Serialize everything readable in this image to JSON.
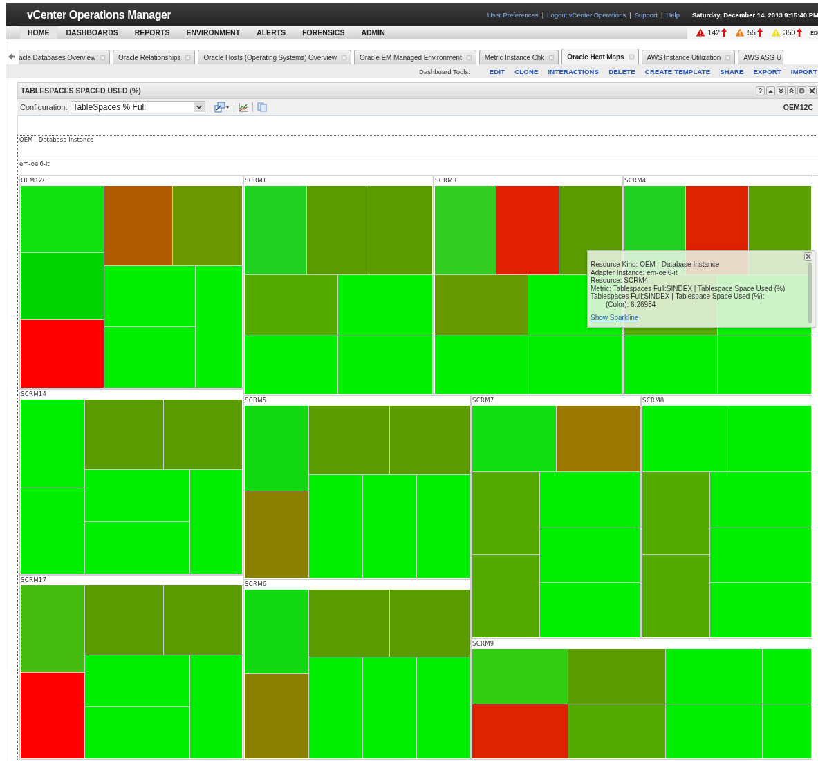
{
  "header": {
    "title": "vCenter Operations Manager",
    "links": [
      "User Preferences",
      "Logout vCenter Operations",
      "Support",
      "Help"
    ],
    "separator": "|",
    "datetime": "Saturday, December 14, 2013 9:15:40 PM"
  },
  "nav": {
    "items": [
      {
        "label": "HOME",
        "selected": true
      },
      {
        "label": "DASHBOARDS",
        "selected": false
      },
      {
        "label": "REPORTS",
        "selected": false
      },
      {
        "label": "ENVIRONMENT",
        "selected": false
      },
      {
        "label": "ALERTS",
        "selected": false
      },
      {
        "label": "FORENSICS",
        "selected": false
      },
      {
        "label": "ADMIN",
        "selected": false
      }
    ],
    "alerts": [
      {
        "kind": "critical",
        "count": "142"
      },
      {
        "kind": "immediate",
        "count": "55"
      },
      {
        "kind": "warning",
        "count": "350"
      }
    ],
    "edit_cut": "EDI"
  },
  "tabs": [
    {
      "label": "acle Databases Overview",
      "selected": false
    },
    {
      "label": "Oracle Relationships",
      "selected": false
    },
    {
      "label": "Oracle Hosts (Operating Systems) Overview",
      "selected": false
    },
    {
      "label": "Oracle EM Managed Environment",
      "selected": false
    },
    {
      "label": "Metric Instance Chk",
      "selected": false
    },
    {
      "label": "Oracle Heat Maps",
      "selected": true
    },
    {
      "label": "AWS Instance Utilization",
      "selected": false
    },
    {
      "label": "AWS ASG U",
      "selected": false
    }
  ],
  "dashboard_tools": {
    "label": "Dashboard Tools:",
    "actions": [
      "EDIT",
      "CLONE",
      "INTERACTIONS",
      "DELETE",
      "CREATE TEMPLATE",
      "SHARE",
      "EXPORT",
      "IMPORT"
    ]
  },
  "panel": {
    "title": "TABLESPACES SPACED USED (%)",
    "help": "?",
    "config_label": "Configuration:",
    "config_value": "TableSpaces % Full",
    "resource": "OEM12C"
  },
  "heatmap": {
    "kind_label": "OEM - Database Instance",
    "adapter_label": "em-oel6-it",
    "groups": [
      {
        "name": "OEM12C",
        "tiles": [
          {
            "color": "#11e011"
          },
          {
            "color": "#00d400"
          },
          {
            "color": "#ff0000"
          },
          {
            "color": "#b05a00"
          },
          {
            "color": "#6a9600"
          },
          {
            "color": "#00ee00"
          },
          {
            "color": "#00ee00"
          },
          {
            "color": "#00ee00"
          }
        ]
      },
      {
        "name": "SCRM1",
        "tiles": [
          {
            "color": "#22d022"
          },
          {
            "color": "#5a9c00"
          },
          {
            "color": "#5a9c00"
          },
          {
            "color": "#55aa00"
          },
          {
            "color": "#00ee00"
          },
          {
            "color": "#00ee00"
          },
          {
            "color": "#00ee00"
          }
        ]
      },
      {
        "name": "SCRM3",
        "tiles": [
          {
            "color": "#33cc22"
          },
          {
            "color": "#e02000"
          },
          {
            "color": "#5a9c00"
          },
          {
            "color": "#669900"
          },
          {
            "color": "#00ee00"
          },
          {
            "color": "#00ee00"
          },
          {
            "color": "#00ee00"
          }
        ]
      },
      {
        "name": "SCRM4",
        "tiles": [
          {
            "color": "#22d022"
          },
          {
            "color": "#dd2200"
          },
          {
            "color": "#5aa000"
          },
          {
            "color": "#55aa00"
          },
          {
            "color": "#00ee00"
          },
          {
            "color": "#00ee00"
          },
          {
            "color": "#00ee00"
          }
        ]
      },
      {
        "name": "SCRM14",
        "tiles": [
          {
            "color": "#00ee00"
          },
          {
            "color": "#00ee00"
          },
          {
            "color": "#5a9c00"
          },
          {
            "color": "#5a9c00"
          },
          {
            "color": "#00ee00"
          },
          {
            "color": "#00ee00"
          },
          {
            "color": "#00ee00"
          }
        ]
      },
      {
        "name": "SCRM5",
        "tiles": [
          {
            "color": "#11d811"
          },
          {
            "color": "#8a8000"
          },
          {
            "color": "#5a9c00"
          },
          {
            "color": "#5a9c00"
          },
          {
            "color": "#00ee00"
          },
          {
            "color": "#00ee00"
          },
          {
            "color": "#00ee00"
          }
        ]
      },
      {
        "name": "SCRM7",
        "tiles": [
          {
            "color": "#11dd11"
          },
          {
            "color": "#997700"
          },
          {
            "color": "#55aa00"
          },
          {
            "color": "#55aa00"
          },
          {
            "color": "#00ee00"
          },
          {
            "color": "#00ee00"
          },
          {
            "color": "#00ee00"
          }
        ]
      },
      {
        "name": "SCRM8",
        "tiles": [
          {
            "color": "#00ee00"
          },
          {
            "color": "#00ee00"
          },
          {
            "color": "#55aa00"
          },
          {
            "color": "#55aa00"
          },
          {
            "color": "#00ee00"
          },
          {
            "color": "#00ee00"
          },
          {
            "color": "#00ee00"
          }
        ]
      },
      {
        "name": "SCRM17",
        "tiles": [
          {
            "color": "#44bb11"
          },
          {
            "color": "#ff0000"
          },
          {
            "color": "#5a9c00"
          },
          {
            "color": "#5a9c00"
          },
          {
            "color": "#00ee00"
          },
          {
            "color": "#00ee00"
          },
          {
            "color": "#00ee00"
          }
        ]
      },
      {
        "name": "SCRM6",
        "tiles": [
          {
            "color": "#11d811"
          },
          {
            "color": "#8a8000"
          },
          {
            "color": "#5a9c00"
          },
          {
            "color": "#5a9c00"
          },
          {
            "color": "#00ee00"
          },
          {
            "color": "#00ee00"
          },
          {
            "color": "#00ee00"
          }
        ]
      },
      {
        "name": "SCRM9",
        "tiles": [
          {
            "color": "#33cc11"
          },
          {
            "color": "#5a9c00"
          },
          {
            "color": "#dd2200"
          },
          {
            "color": "#55aa00"
          },
          {
            "color": "#00ee00"
          },
          {
            "color": "#00ee00"
          },
          {
            "color": "#00ee00"
          },
          {
            "color": "#00ee00"
          }
        ]
      }
    ]
  },
  "tooltip": {
    "lines": [
      "Resource Kind: OEM - Database Instance",
      "Adapter Instance: em-oel6-it",
      "Resource: SCRM4",
      "Metric: Tablespaces Full:SINDEX | Tablespace Space Used (%)",
      "Tablespaces Full:SINDEX | Tablespace Space Used (%): (Color): 6.26984"
    ],
    "link": "Show Sparkline"
  }
}
